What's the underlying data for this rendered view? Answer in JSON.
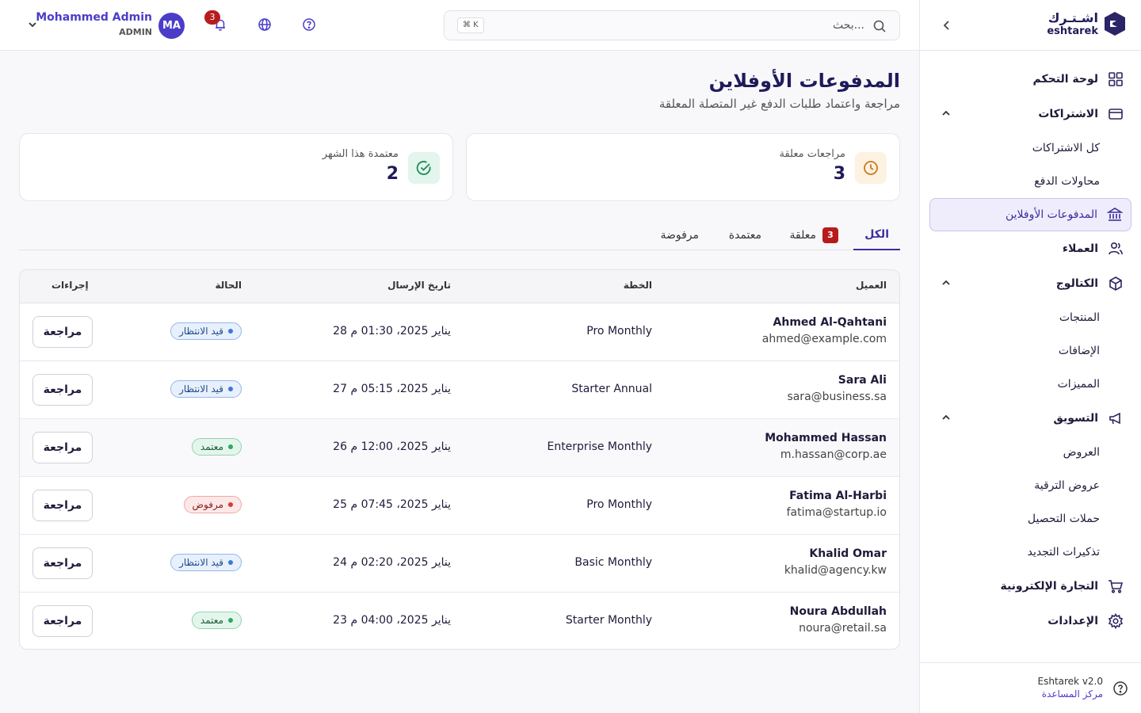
{
  "brand": {
    "name_ar": "اشـتـرك",
    "name_en": "eshtarek"
  },
  "sidebar": {
    "items": [
      {
        "label": "لوحة التحكم",
        "icon": "dashboard-grid-icon"
      },
      {
        "label": "الاشتراكات",
        "icon": "card-icon",
        "expanded": true,
        "children": [
          {
            "label": "كل الاشتراكات"
          },
          {
            "label": "محاولات الدفع"
          },
          {
            "label": "المدفوعات الأوفلاين",
            "active": true,
            "icon": "bank-icon"
          }
        ]
      },
      {
        "label": "العملاء",
        "icon": "users-icon"
      },
      {
        "label": "الكتالوج",
        "icon": "box-icon",
        "expanded": true,
        "children": [
          {
            "label": "المنتجات"
          },
          {
            "label": "الإضافات"
          },
          {
            "label": "المميزات"
          }
        ]
      },
      {
        "label": "التسويق",
        "icon": "megaphone-icon",
        "expanded": true,
        "children": [
          {
            "label": "العروض"
          },
          {
            "label": "عروض الترقية"
          },
          {
            "label": "حملات التحصيل"
          },
          {
            "label": "تذكيرات التجديد"
          }
        ]
      },
      {
        "label": "التجارة الإلكترونية",
        "icon": "cart-icon"
      },
      {
        "label": "الإعدادات",
        "icon": "gear-icon"
      }
    ],
    "footer": {
      "version": "Eshtarek v2.0",
      "help": "مركز المساعدة"
    }
  },
  "topbar": {
    "search_placeholder": "بحث...",
    "shortcut": "⌘ K",
    "notifications_count": "3",
    "user": {
      "name": "Mohammed Admin",
      "role": "ADMIN",
      "initials": "MA"
    }
  },
  "page": {
    "title": "المدفوعات الأوفلاين",
    "subtitle": "مراجعة واعتماد طلبات الدفع غير المتصلة المعلقة"
  },
  "stats": {
    "pending": {
      "label": "مراجعات معلقة",
      "value": "3"
    },
    "approved": {
      "label": "معتمدة هذا الشهر",
      "value": "2"
    }
  },
  "tabs": {
    "all": "الكل",
    "pending": "معلقة",
    "pending_count": "3",
    "approved": "معتمدة",
    "rejected": "مرفوضة"
  },
  "table": {
    "headers": {
      "customer": "العميل",
      "plan": "الخطة",
      "date": "تاريخ الإرسال",
      "status": "الحالة",
      "actions": "إجراءات"
    },
    "action_label": "مراجعة",
    "rows": [
      {
        "name": "Ahmed Al-Qahtani",
        "email": "ahmed@example.com",
        "plan": "Pro Monthly",
        "date": "28 يناير 2025، 01:30 م",
        "status": "قيد الانتظار",
        "status_type": "pending"
      },
      {
        "name": "Sara Ali",
        "email": "sara@business.sa",
        "plan": "Starter Annual",
        "date": "27 يناير 2025، 05:15 م",
        "status": "قيد الانتظار",
        "status_type": "pending"
      },
      {
        "name": "Mohammed Hassan",
        "email": "m.hassan@corp.ae",
        "plan": "Enterprise Monthly",
        "date": "26 يناير 2025، 12:00 م",
        "status": "معتمد",
        "status_type": "approved"
      },
      {
        "name": "Fatima Al-Harbi",
        "email": "fatima@startup.io",
        "plan": "Pro Monthly",
        "date": "25 يناير 2025، 07:45 م",
        "status": "مرفوض",
        "status_type": "rejected"
      },
      {
        "name": "Khalid Omar",
        "email": "khalid@agency.kw",
        "plan": "Basic Monthly",
        "date": "24 يناير 2025، 02:20 م",
        "status": "قيد الانتظار",
        "status_type": "pending"
      },
      {
        "name": "Noura Abdullah",
        "email": "noura@retail.sa",
        "plan": "Starter Monthly",
        "date": "23 يناير 2025، 04:00 م",
        "status": "معتمد",
        "status_type": "approved"
      }
    ]
  },
  "colors": {
    "accent": "#3b2ea0",
    "brand": "#1f1b5a",
    "badge": "#b71c1c"
  }
}
